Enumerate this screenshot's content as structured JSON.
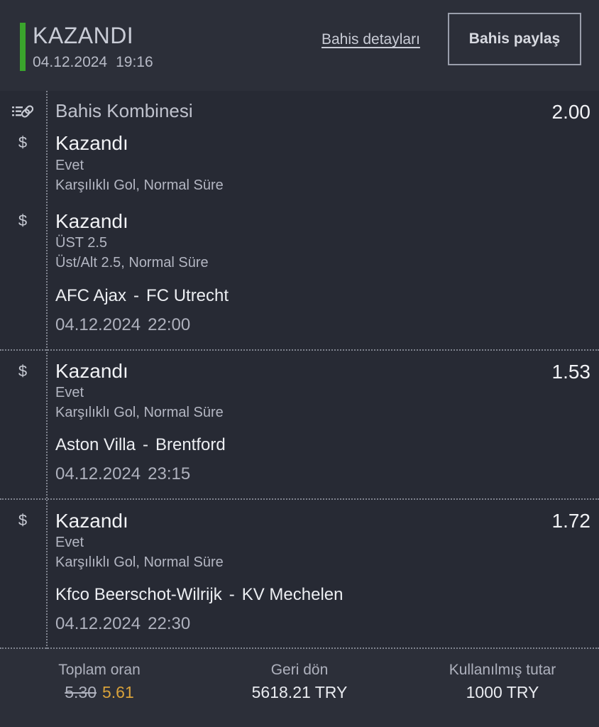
{
  "header": {
    "status": "KAZANDI",
    "date": "04.12.2024",
    "time": "19:16",
    "details_link": "Bahis detayları",
    "share_button": "Bahis paylaş",
    "status_color": "#3aa42c"
  },
  "combo": {
    "label": "Bahis Kombinesi",
    "odds": "2.00",
    "icon": "combo-link-icon"
  },
  "selections": [
    {
      "result": "Kazandı",
      "pick": "Evet",
      "market": "Karşılıklı Gol, Normal Süre",
      "icon": "dollar-icon"
    },
    {
      "result": "Kazandı",
      "pick": "ÜST 2.5",
      "market": "Üst/Alt 2.5, Normal Süre",
      "icon": "dollar-icon",
      "home": "AFC Ajax",
      "away": "FC Utrecht",
      "date": "04.12.2024",
      "time": "22:00"
    },
    {
      "result": "Kazandı",
      "pick": "Evet",
      "market": "Karşılıklı Gol, Normal Süre",
      "icon": "dollar-icon",
      "odds": "1.53",
      "home": "Aston Villa",
      "away": "Brentford",
      "date": "04.12.2024",
      "time": "23:15"
    },
    {
      "result": "Kazandı",
      "pick": "Evet",
      "market": "Karşılıklı Gol, Normal Süre",
      "icon": "dollar-icon",
      "odds": "1.72",
      "home": "Kfco Beerschot-Wilrijk",
      "away": "KV Mechelen",
      "date": "04.12.2024",
      "time": "22:30"
    }
  ],
  "match_separator": "-",
  "footer": {
    "total_odds_label": "Toplam oran",
    "old_odds": "5.30",
    "new_odds": "5.61",
    "return_label": "Geri dön",
    "return_value": "5618.21 TRY",
    "stake_label": "Kullanılmış tutar",
    "stake_value": "1000 TRY",
    "boost_color": "#d9a23a"
  }
}
